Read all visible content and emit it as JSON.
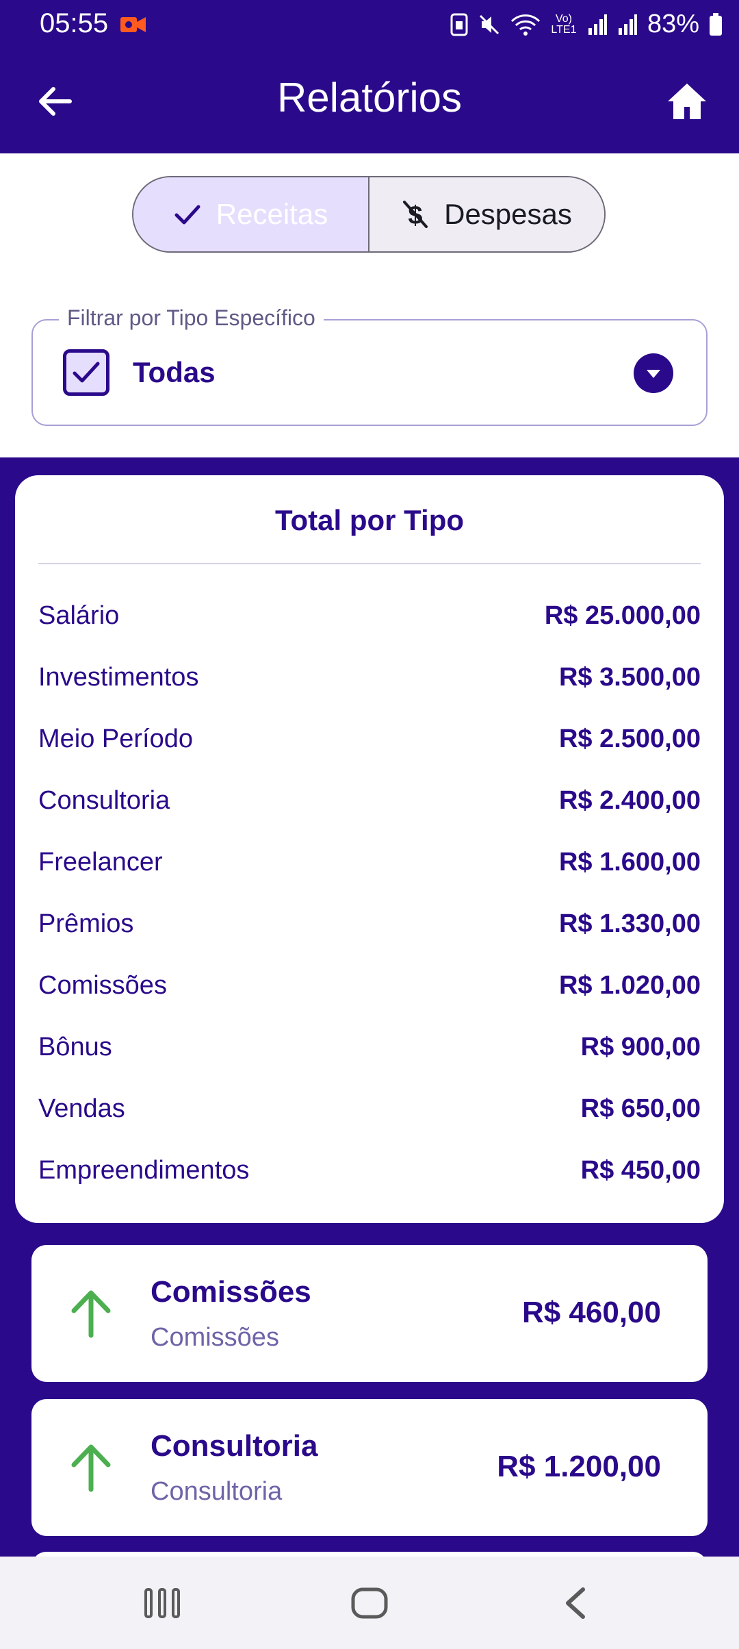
{
  "status_bar": {
    "time": "05:55",
    "battery": "83%",
    "network_label": "Vo) LTE1"
  },
  "app_bar": {
    "title": "Relatórios"
  },
  "segmented": {
    "options": [
      {
        "label": "Receitas",
        "selected": true
      },
      {
        "label": "Despesas",
        "selected": false
      }
    ]
  },
  "filter": {
    "label": "Filtrar por Tipo Específico",
    "value": "Todas"
  },
  "totals": {
    "title": "Total por Tipo",
    "rows": [
      {
        "label": "Salário",
        "value": "R$ 25.000,00"
      },
      {
        "label": "Investimentos",
        "value": "R$ 3.500,00"
      },
      {
        "label": "Meio Período",
        "value": "R$ 2.500,00"
      },
      {
        "label": "Consultoria",
        "value": "R$ 2.400,00"
      },
      {
        "label": "Freelancer",
        "value": "R$ 1.600,00"
      },
      {
        "label": "Prêmios",
        "value": "R$ 1.330,00"
      },
      {
        "label": "Comissões",
        "value": "R$ 1.020,00"
      },
      {
        "label": "Bônus",
        "value": "R$ 900,00"
      },
      {
        "label": "Vendas",
        "value": "R$ 650,00"
      },
      {
        "label": "Empreendimentos",
        "value": "R$ 450,00"
      }
    ]
  },
  "transactions": [
    {
      "name": "Comissões",
      "category": "Comissões",
      "amount": "R$ 460,00",
      "icon": "arrow-up-icon"
    },
    {
      "name": "Consultoria",
      "category": "Consultoria",
      "amount": "R$ 1.200,00",
      "icon": "arrow-up-icon"
    }
  ],
  "colors": {
    "primary": "#2a0a8a",
    "selected_segment": "#e6defd",
    "income_arrow": "#4caf50"
  }
}
